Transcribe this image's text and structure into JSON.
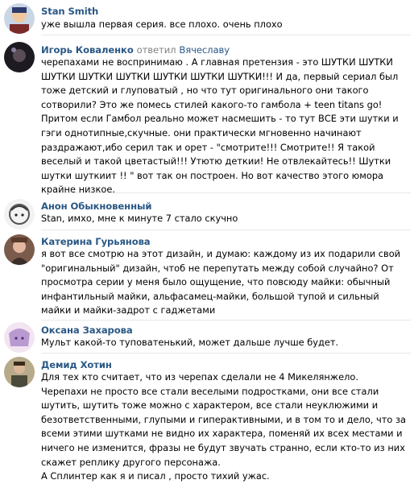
{
  "comments": [
    {
      "author": "Stan Smith",
      "reply_label": "",
      "reply_name": "",
      "lines": [
        "уже вышла первая серия. все плохо. очень плохо"
      ]
    },
    {
      "author": "Игорь Коваленко",
      "reply_label": "ответил",
      "reply_name": "Вячеславу",
      "lines": [
        "черепахами не воспринимаю . А главная претензия - это ШУТКИ ШУТКИ",
        "ШУТКИ ШУТКИ ШУТКИ ШУТКИ ШУТКИ ШУТКИ!!! И да, первый сериал был",
        "тоже детский и глуповатый , но что тут оригинального они такого",
        "сотворили? Это же помесь стилей какого-то гамбола + teen titans go!",
        "Притом если Гамбол реально может насмешить - то тут ВСЕ эти шутки и",
        "гэги однотипные,скучные. они практически мгновенно начинают",
        "раздражают,ибо серил так и орет - \"смотрите!!! Смотрите!! Я такой",
        "веселый и такой цветастый!!! Утютю деткии! Не отвлекайтесь!! Шутки",
        "шутки шуткиит !! \" вот так он построен. Но вот качество этого юмора",
        "крайне низкое."
      ]
    },
    {
      "author": "Анон Обыкновенный",
      "reply_label": "",
      "reply_name": "",
      "lines": [
        "Stan, имхо, мне к минуте 7 стало скучно"
      ]
    },
    {
      "author": "Катерина Гурьянова",
      "reply_label": "",
      "reply_name": "",
      "lines": [
        "я вот все смотрю на этот дизайн, и думаю: каждому из их подарили свой",
        "\"оригинальный\" дизайн, чтоб не перепутать между собой случайно? От",
        "просмотра серии у меня было ощущение, что повсюду майки: обычный",
        "инфантильный майки, альфасамец-майки, большой тупой и сильный",
        "майки и майки-задрот с гаджетами"
      ]
    },
    {
      "author": "Оксана Захарова",
      "reply_label": "",
      "reply_name": "",
      "lines": [
        "Мульт какой-то туповатенький, может дальше лучше будет."
      ]
    },
    {
      "author": "Демид Хотин",
      "reply_label": "",
      "reply_name": "",
      "lines": [
        "Для тех кто считает, что из черепах сделали не 4 Микелянжело.",
        "Черепахи не просто все стали веселыми подростками, они все стали",
        "шутить, шутить тоже можно с характером, все стали неуклюжими и",
        "безответственными, глупыми и гиперактивными, и в том то и дело, что за",
        "всеми этими шутками не видно их характера, поменяй их всех местами и",
        "ничего не изменится, фразы не будут звучать странно, если кто-то из них",
        "скажет реплику другого персонажа.",
        "А Сплинтер как я и писал , просто тихий ужас."
      ]
    }
  ],
  "colors": {
    "author": "#2a5885",
    "reply_label": "#828282",
    "text": "#000000",
    "divider": "#e7e8ec"
  }
}
